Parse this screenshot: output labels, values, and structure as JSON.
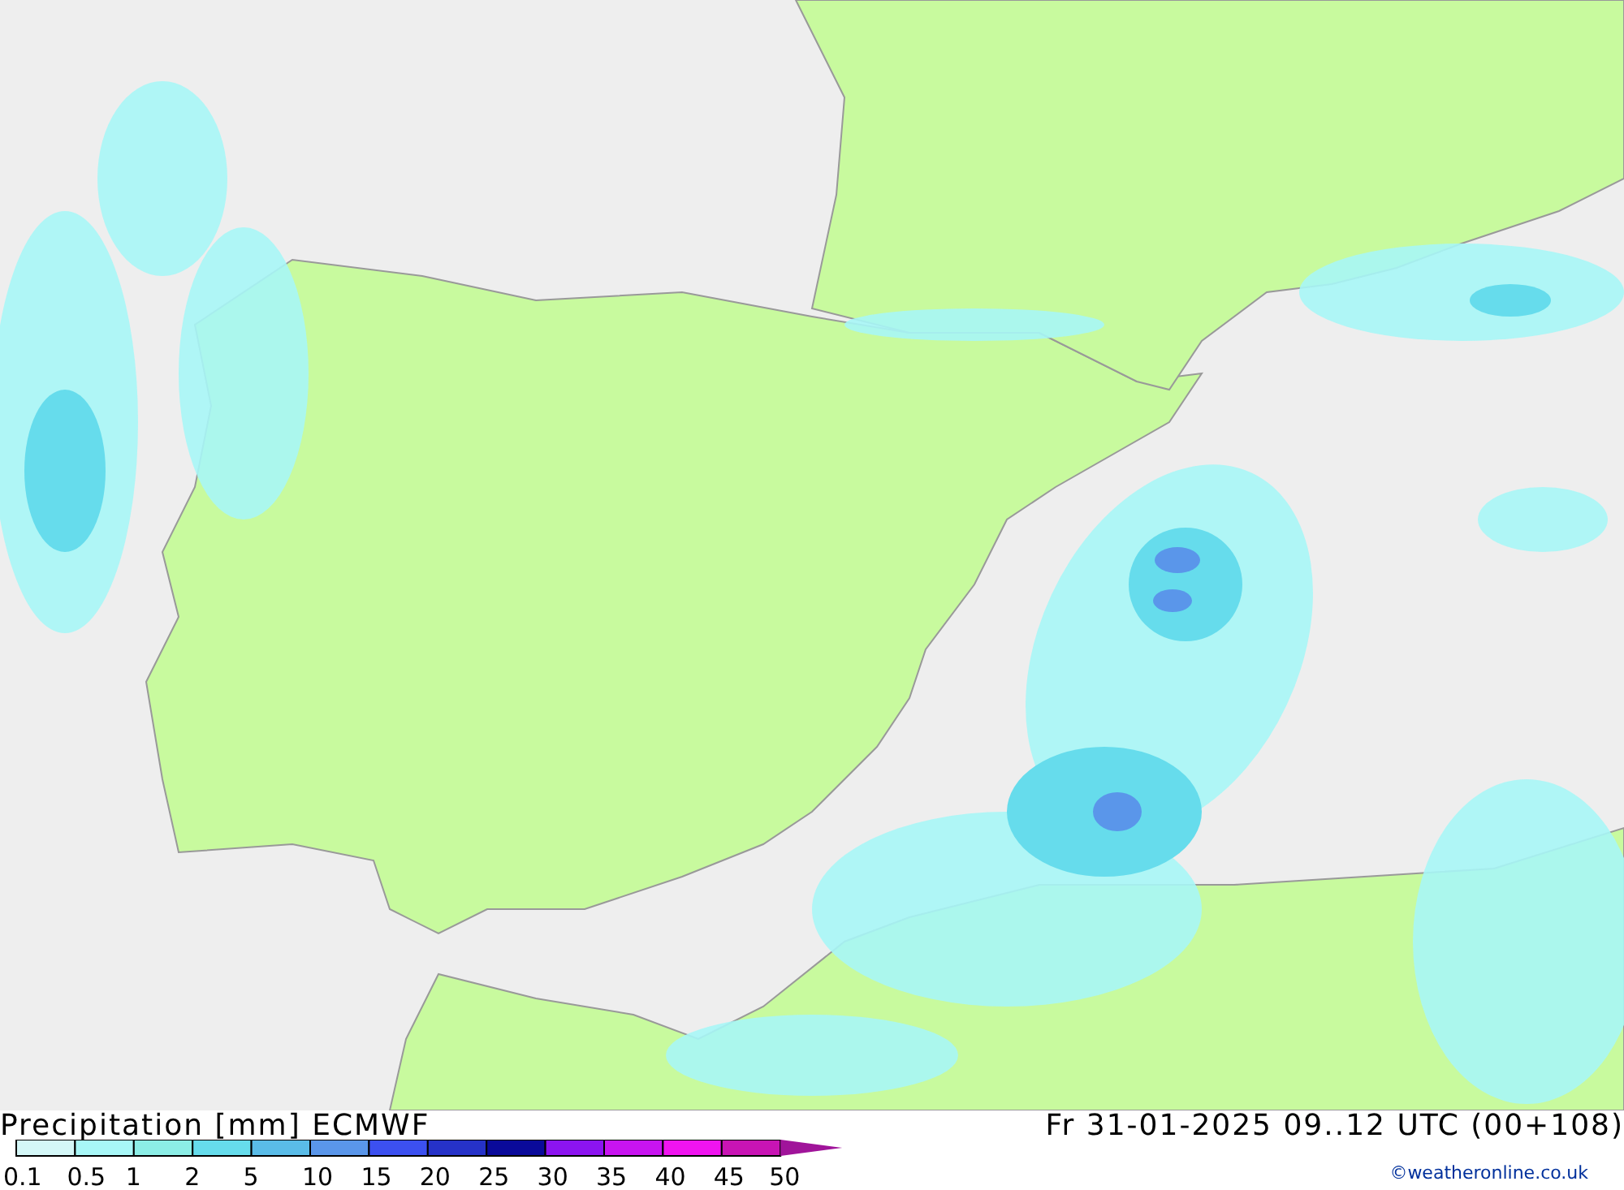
{
  "title": "Precipitation [mm] ECMWF",
  "valid_time": "Fr 31-01-2025 09..12 UTC (00+108)",
  "legend": [
    {
      "label": "0.1",
      "color": "#d4f7f7"
    },
    {
      "label": "0.5",
      "color": "#a8f7f7"
    },
    {
      "label": "1",
      "color": "#8ceee6"
    },
    {
      "label": "2",
      "color": "#66dcec"
    },
    {
      "label": "5",
      "color": "#5abce8"
    },
    {
      "label": "10",
      "color": "#5a96ea"
    },
    {
      "label": "15",
      "color": "#3c50f0"
    },
    {
      "label": "20",
      "color": "#2632c8"
    },
    {
      "label": "25",
      "color": "#0a0a9a"
    },
    {
      "label": "30",
      "color": "#8c14f0"
    },
    {
      "label": "35",
      "color": "#c814f0"
    },
    {
      "label": "40",
      "color": "#f014f0"
    },
    {
      "label": "45",
      "color": "#c814b4"
    }
  ],
  "legend_end": {
    "label": "50",
    "color": "#a0149a"
  },
  "copyright": "©weatheronline.co.uk"
}
